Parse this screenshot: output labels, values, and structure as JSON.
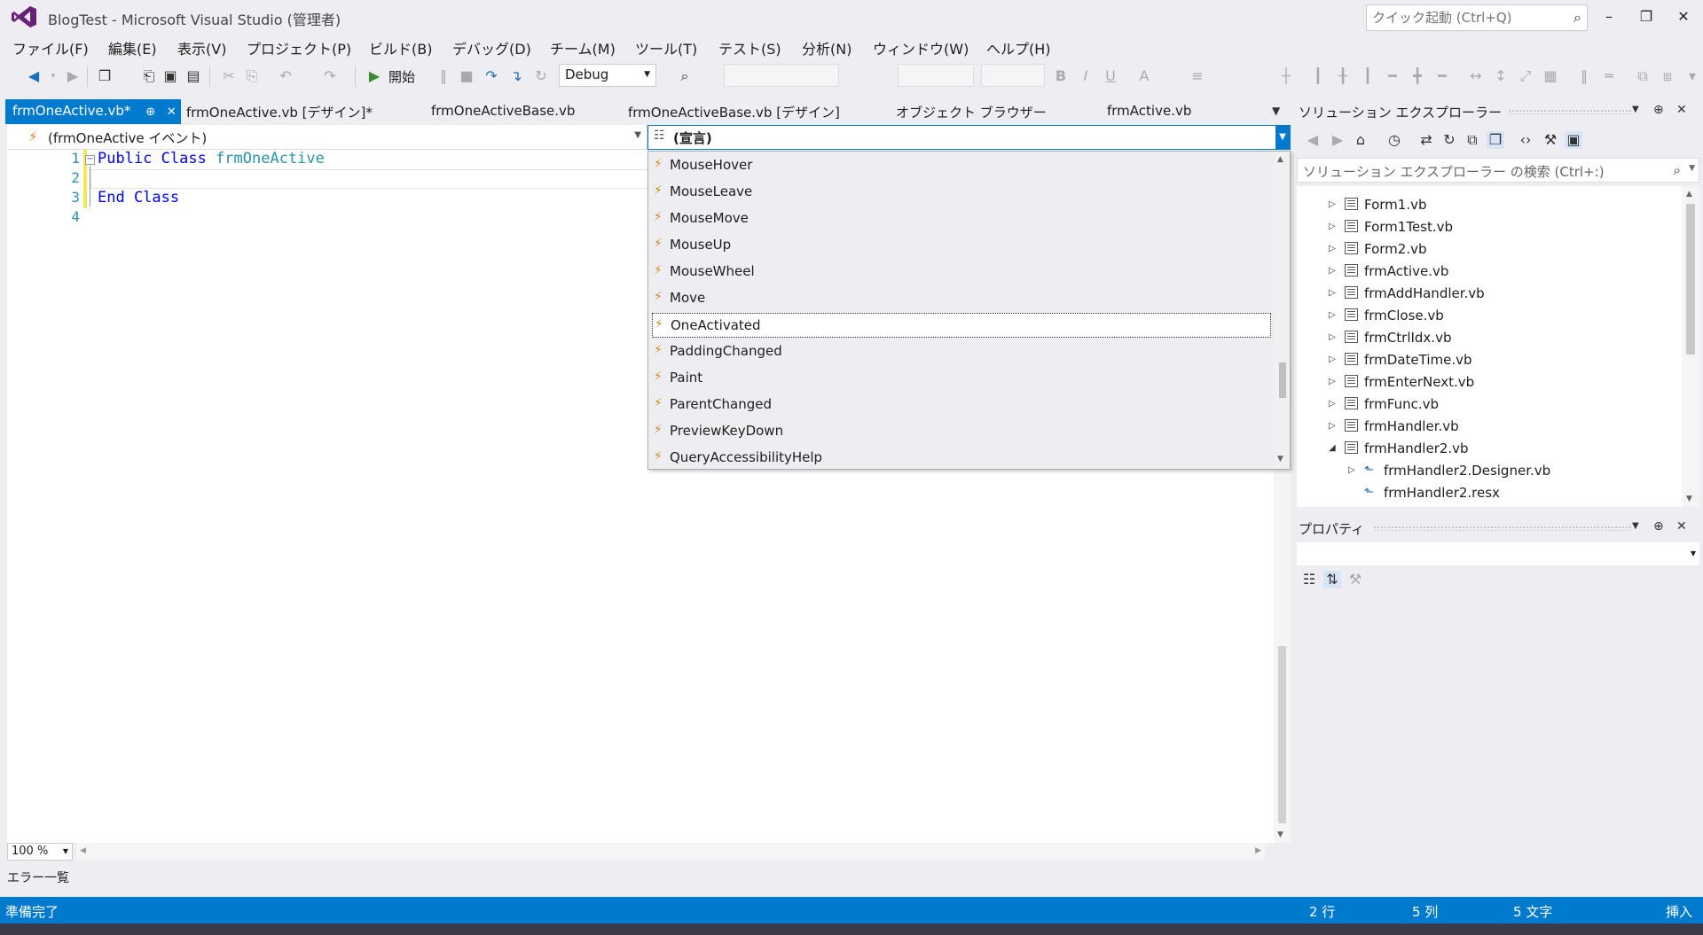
{
  "window": {
    "title": "BlogTest - Microsoft Visual Studio (管理者)",
    "quick_launch_placeholder": "クイック起動 (Ctrl+Q)"
  },
  "menu": [
    "ファイル(F)",
    "編集(E)",
    "表示(V)",
    "プロジェクト(P)",
    "ビルド(B)",
    "デバッグ(D)",
    "チーム(M)",
    "ツール(T)",
    "テスト(S)",
    "分析(N)",
    "ウィンドウ(W)",
    "ヘルプ(H)"
  ],
  "toolbar": {
    "start_label": "開始",
    "configuration": "Debug"
  },
  "tabs": [
    {
      "label": "frmOneActive.vb*",
      "active": true
    },
    {
      "label": "frmOneActive.vb [デザイン]*",
      "active": false
    },
    {
      "label": "frmOneActiveBase.vb",
      "active": false
    },
    {
      "label": "frmOneActiveBase.vb [デザイン]",
      "active": false
    },
    {
      "label": "オブジェクト ブラウザー",
      "active": false
    },
    {
      "label": "frmActive.vb",
      "active": false
    }
  ],
  "editor": {
    "nav_left": "(frmOneActive イベント)",
    "nav_right": "(宣言)",
    "line_numbers": [
      "1",
      "2",
      "3",
      "4"
    ],
    "code": {
      "line1_kw": "Public Class ",
      "line1_type": "frmOneActive",
      "line3_kw": "End Class"
    },
    "zoom": "100 %"
  },
  "dropdown": {
    "items": [
      "MouseHover",
      "MouseLeave",
      "MouseMove",
      "MouseUp",
      "MouseWheel",
      "Move",
      "OneActivated",
      "PaddingChanged",
      "Paint",
      "ParentChanged",
      "PreviewKeyDown",
      "QueryAccessibilityHelp"
    ],
    "selected": "OneActivated"
  },
  "solution_explorer": {
    "title": "ソリューション エクスプローラー",
    "search_placeholder": "ソリューション エクスプローラー の検索 (Ctrl+:)",
    "items": [
      {
        "label": "Form1.vb",
        "level": 0,
        "expander": "collapsed"
      },
      {
        "label": "Form1Test.vb",
        "level": 0,
        "expander": "collapsed"
      },
      {
        "label": "Form2.vb",
        "level": 0,
        "expander": "collapsed"
      },
      {
        "label": "frmActive.vb",
        "level": 0,
        "expander": "collapsed"
      },
      {
        "label": "frmAddHandler.vb",
        "level": 0,
        "expander": "collapsed"
      },
      {
        "label": "frmClose.vb",
        "level": 0,
        "expander": "collapsed"
      },
      {
        "label": "frmCtrlIdx.vb",
        "level": 0,
        "expander": "collapsed"
      },
      {
        "label": "frmDateTime.vb",
        "level": 0,
        "expander": "collapsed"
      },
      {
        "label": "frmEnterNext.vb",
        "level": 0,
        "expander": "collapsed"
      },
      {
        "label": "frmFunc.vb",
        "level": 0,
        "expander": "collapsed"
      },
      {
        "label": "frmHandler.vb",
        "level": 0,
        "expander": "collapsed"
      },
      {
        "label": "frmHandler2.vb",
        "level": 0,
        "expander": "expanded"
      },
      {
        "label": "frmHandler2.Designer.vb",
        "level": 1,
        "expander": "collapsed"
      },
      {
        "label": "frmHandler2.resx",
        "level": 1,
        "expander": "none"
      }
    ]
  },
  "properties": {
    "title": "プロパティ"
  },
  "error_list": {
    "title": "エラー一覧"
  },
  "status": {
    "message": "準備完了",
    "line": "2 行",
    "column": "5 列",
    "char": "5 文字",
    "mode": "挿入"
  },
  "colors": {
    "accent": "#007ACC",
    "chrome": "#EEEEF2",
    "keyword": "#0000FF",
    "type": "#2B91AF",
    "event_icon": "#D68A1E"
  }
}
